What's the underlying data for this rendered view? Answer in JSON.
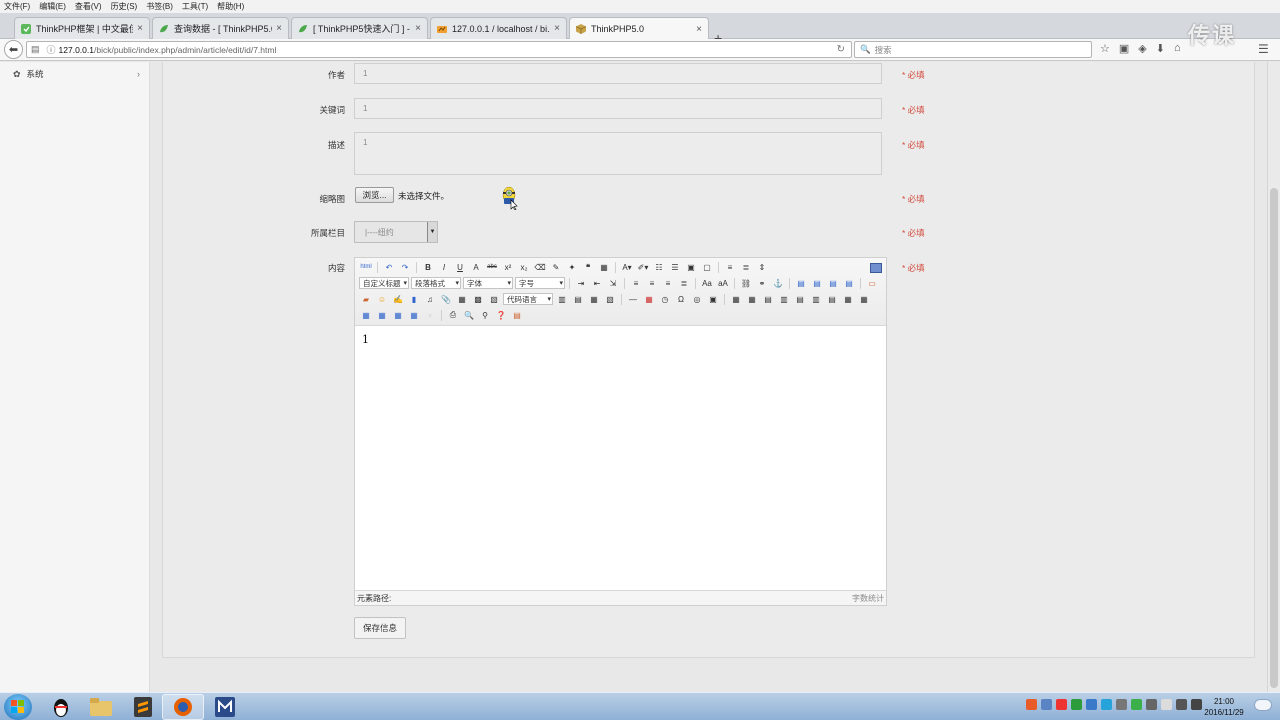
{
  "menu": [
    "文件(F)",
    "编辑(E)",
    "查看(V)",
    "历史(S)",
    "书签(B)",
    "工具(T)",
    "帮助(H)"
  ],
  "tabs": [
    {
      "label": "ThinkPHP框架 | 中文最佳...",
      "icon": "thinkphp-logo-icon"
    },
    {
      "label": "查询数据 - [ ThinkPHP5.0...",
      "icon": "thinkphp-leaf-icon"
    },
    {
      "label": "[ ThinkPHP5快速入门 ] - ...",
      "icon": "thinkphp-leaf-icon"
    },
    {
      "label": "127.0.0.1 / localhost / bi...",
      "icon": "phpmyadmin-icon"
    },
    {
      "label": "ThinkPHP5.0",
      "icon": "thinkphp-cube-icon",
      "active": true
    }
  ],
  "url": {
    "host": "127.0.0.1",
    "path": "/bick/public/index.php/admin/article/edit/id/7.html"
  },
  "search_placeholder": "搜索",
  "watermark": "传课",
  "sidebar": {
    "items": [
      {
        "label": "系统",
        "icon": "gear-icon"
      }
    ]
  },
  "form": {
    "author": {
      "label": "作者",
      "value": "1"
    },
    "keywords": {
      "label": "关键词",
      "value": "1"
    },
    "description": {
      "label": "描述",
      "value": "1"
    },
    "thumbnail": {
      "label": "缩略图",
      "button": "浏览...",
      "status": "未选择文件。"
    },
    "category": {
      "label": "所属栏目",
      "value": "|----纽约"
    },
    "content": {
      "label": "内容",
      "value": "1"
    },
    "required": "* 必填",
    "save": "保存信息"
  },
  "editor": {
    "combos": [
      "自定义标题",
      "段落格式",
      "字体",
      "字号"
    ],
    "code_combo": "代码语言",
    "status_path": "元素路径:",
    "word_count": "字数统计"
  },
  "clock": {
    "time": "21:00",
    "date": "2016/11/29"
  },
  "colors": {
    "required": "#d14a3b",
    "accent": "#1f6fb8"
  }
}
